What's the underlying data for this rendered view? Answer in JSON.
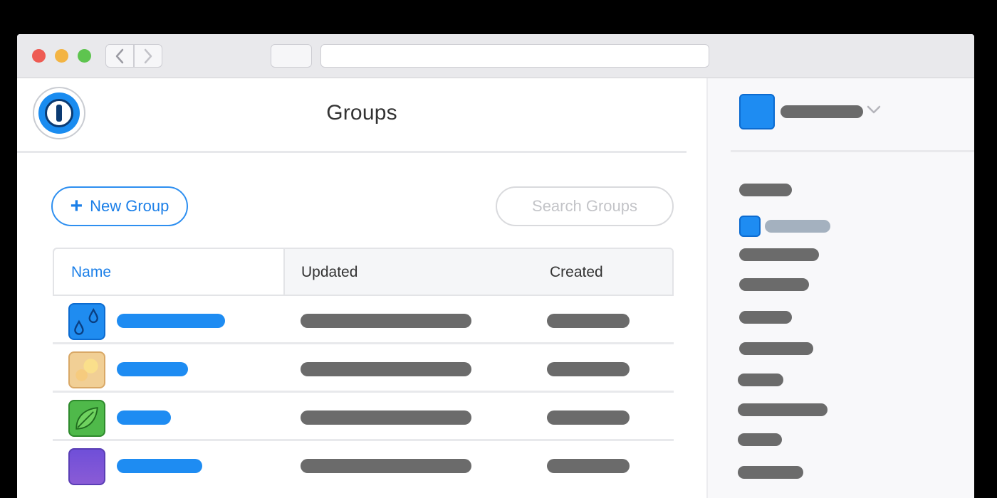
{
  "window": {
    "controls": [
      "close",
      "minimize",
      "zoom"
    ],
    "nav": {
      "back_icon": "chevron-left-icon",
      "forward_icon": "chevron-right-icon"
    }
  },
  "app": {
    "logo_icon": "1password-keyhole-icon",
    "page_title": "Groups"
  },
  "toolbar": {
    "new_group_plus": "+",
    "new_group_label": "New Group",
    "search_placeholder": "Search Groups"
  },
  "table": {
    "columns": [
      "Name",
      "Updated",
      "Created"
    ],
    "rows": [
      {
        "icon": "water-drops-icon"
      },
      {
        "icon": "sun-icon"
      },
      {
        "icon": "leaf-icon"
      },
      {
        "icon": "night-sky-icon"
      }
    ]
  },
  "sidebar": {
    "account_icon": "account-avatar-icon",
    "dropdown_icon": "chevron-down-icon",
    "item_icon": "vault-icon"
  },
  "colors": {
    "accent": "#1e8cf2",
    "placeholder_bar": "#6b6b6b",
    "sidebar_highlight": "#a4b1bf"
  }
}
